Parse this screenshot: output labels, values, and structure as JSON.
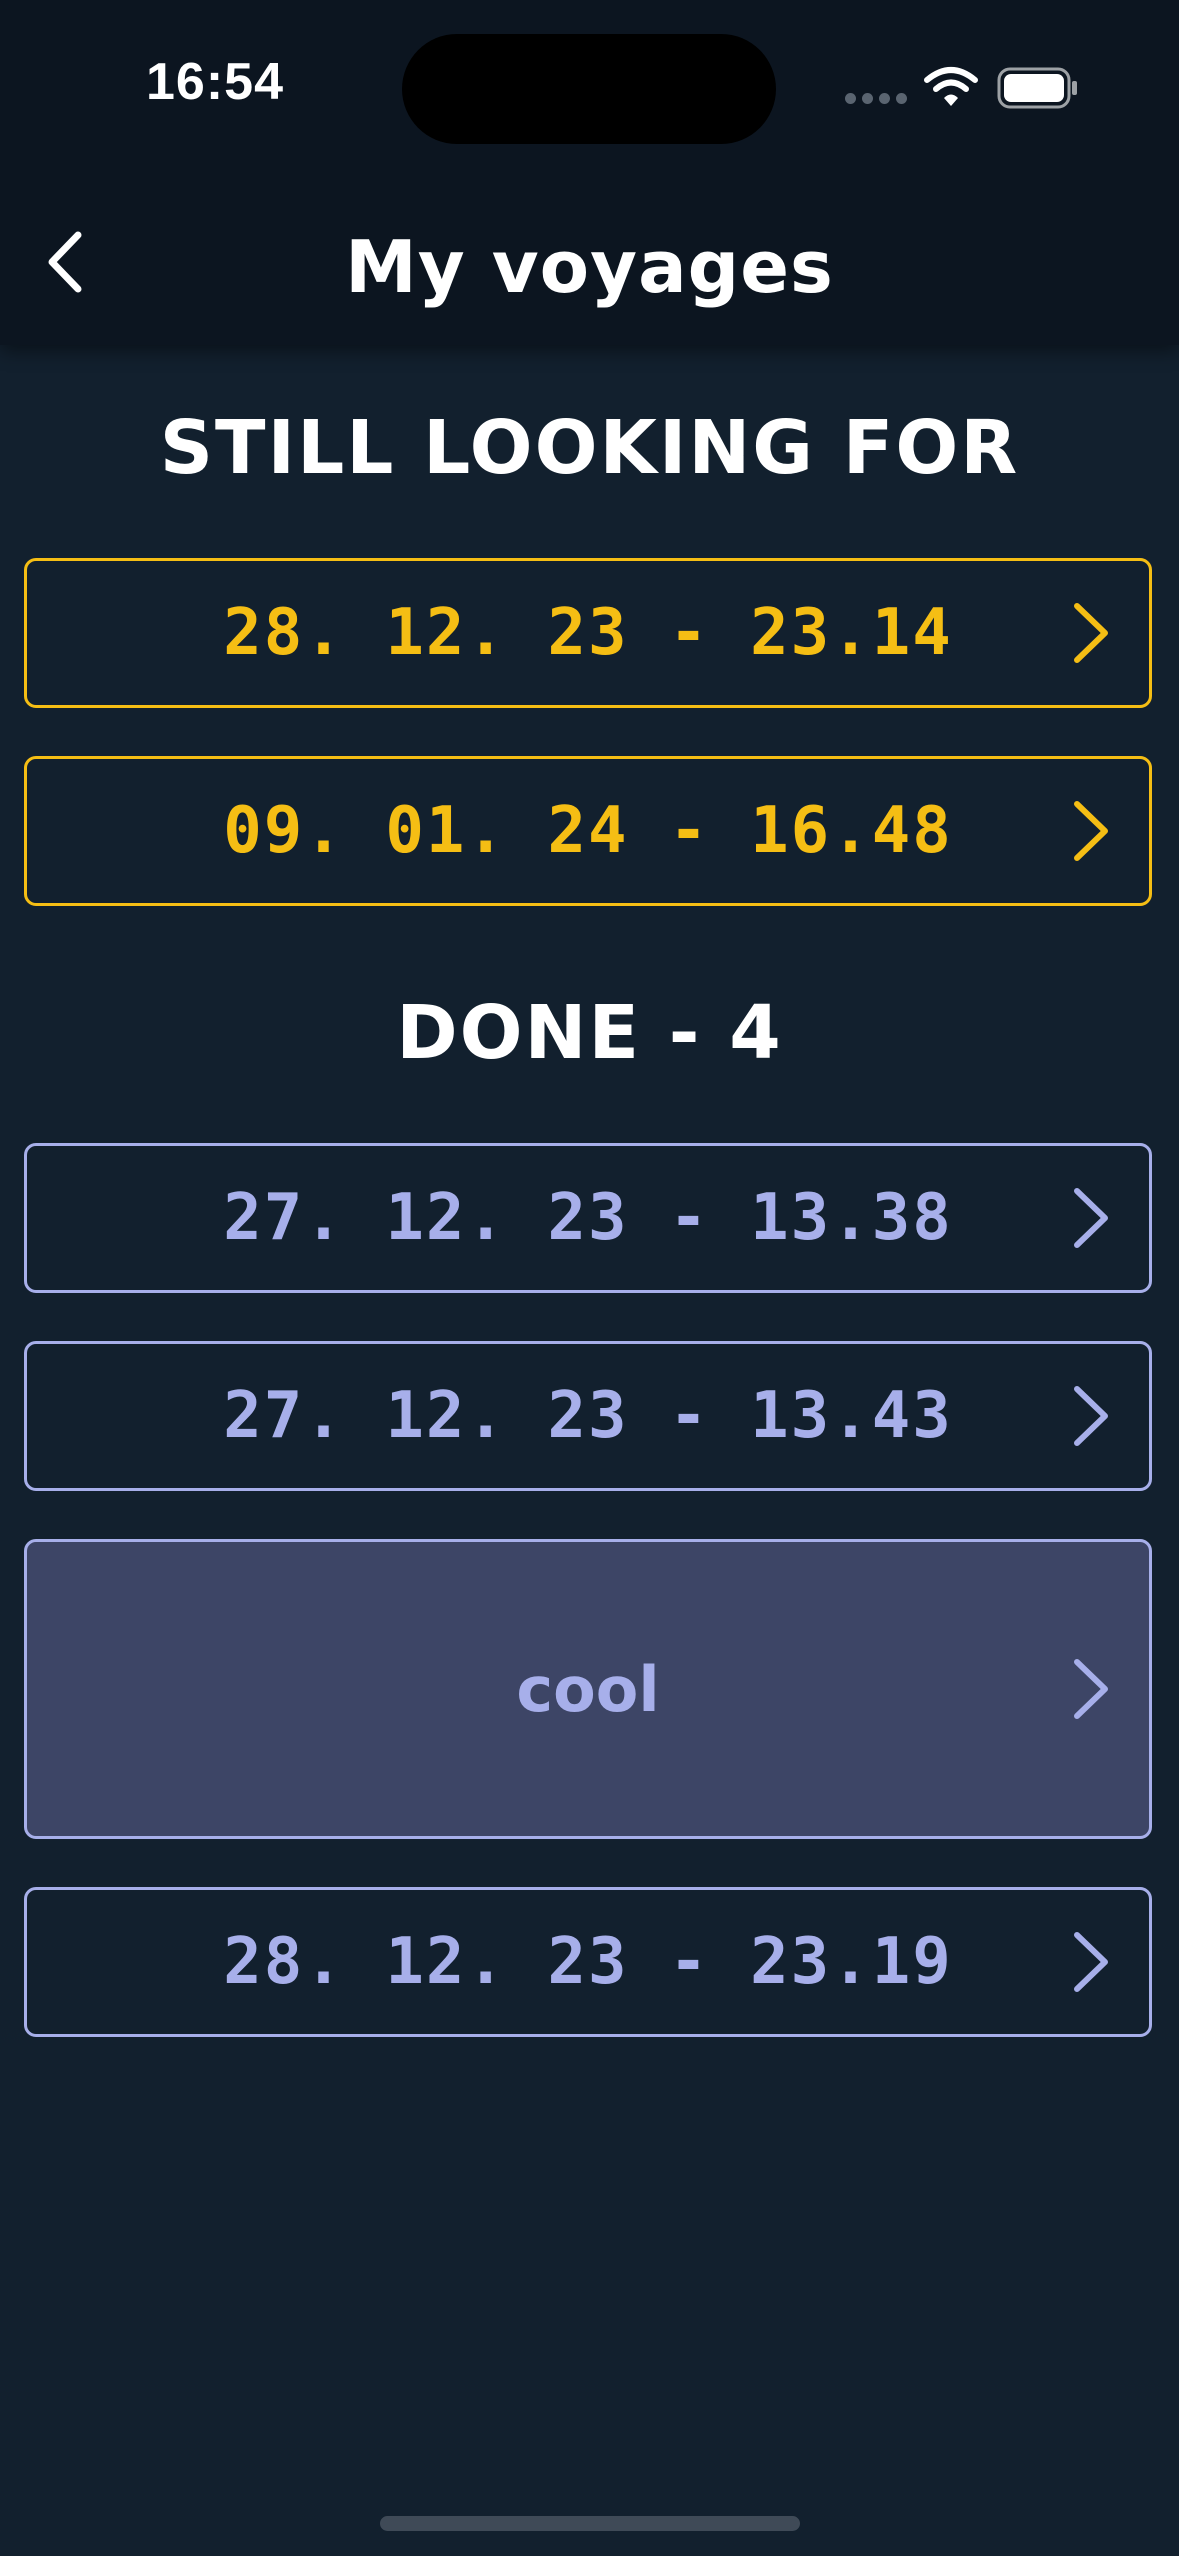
{
  "status_bar": {
    "time": "16:54",
    "icons": [
      "signal-dots-icon",
      "wifi-icon",
      "battery-icon"
    ]
  },
  "nav": {
    "back_icon": "chevron-left-icon",
    "title": "My voyages"
  },
  "sections": {
    "pending": {
      "heading": "STILL LOOKING FOR",
      "items": [
        {
          "label": "28. 12. 23 - 23.14"
        },
        {
          "label": "09. 01. 24 - 16.48"
        }
      ]
    },
    "done": {
      "heading": "DONE - 4",
      "items": [
        {
          "label": "27. 12. 23 - 13.38"
        },
        {
          "label": "27. 12. 23 - 13.43"
        },
        {
          "label": "cool"
        },
        {
          "label": "28. 12. 23 - 23.19"
        }
      ]
    }
  },
  "colors": {
    "background": "#12202e",
    "header": "#0c1520",
    "pending_accent": "#f5be14",
    "done_accent": "#a7afea",
    "highlight_fill": "#3d4566"
  }
}
